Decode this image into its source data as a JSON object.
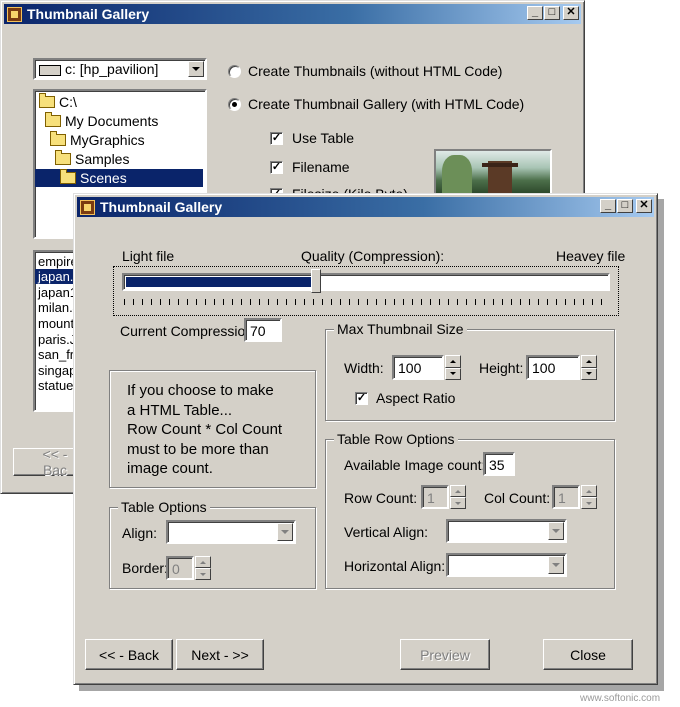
{
  "back_window": {
    "title": "Thumbnail Gallery",
    "drive": "c: [hp_pavilion]",
    "tree": [
      "C:\\",
      "My Documents",
      "MyGraphics",
      "Samples",
      "Scenes"
    ],
    "files": [
      "empire",
      "japan.j",
      "japan1",
      "milan.J",
      "mount",
      "paris.J",
      "san_fr",
      "singap",
      "statue"
    ],
    "radio_thumbs": "Create Thumbnails (without HTML Code)",
    "radio_gallery": "Create Thumbnail Gallery (with HTML Code)",
    "check_use_table": "Use Table",
    "check_filename": "Filename",
    "check_filesize": "Filesize (Kilo Byte)",
    "back_button": "<< - Bac"
  },
  "front_window": {
    "title": "Thumbnail Gallery",
    "light_file": "Light file",
    "quality": "Quality (Compression):",
    "heavy_file": "Heavey file",
    "slider_value": 0.4,
    "current_compression_label": "Current Compression:",
    "current_compression_value": "70",
    "info_lines": [
      "If you choose to make",
      "a HTML Table...",
      "Row Count * Col Count",
      "must to be more than",
      "image count."
    ],
    "max_thumb": {
      "title": "Max Thumbnail Size",
      "width_label": "Width:",
      "width_value": "100",
      "height_label": "Height:",
      "height_value": "100",
      "aspect_label": "Aspect Ratio"
    },
    "table_options": {
      "title": "Table Options",
      "align_label": "Align:",
      "border_label": "Border:",
      "border_value": "0"
    },
    "row_options": {
      "title": "Table Row Options",
      "available_label": "Available Image count:",
      "available_value": "35",
      "row_count_label": "Row Count:",
      "row_count_value": "1",
      "col_count_label": "Col Count:",
      "col_count_value": "1",
      "valign_label": "Vertical Align:",
      "halign_label": "Horizontal Align:"
    },
    "buttons": {
      "back": "<< - Back",
      "next": "Next - >>",
      "preview": "Preview",
      "close": "Close"
    }
  },
  "watermark": "www.softonic.com"
}
